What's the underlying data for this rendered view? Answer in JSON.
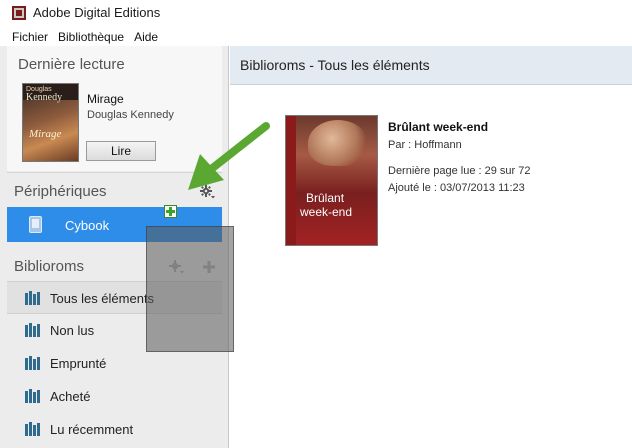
{
  "window": {
    "title": "Adobe Digital Editions"
  },
  "menu": [
    "Fichier",
    "Bibliothèque",
    "Aide"
  ],
  "sidebar": {
    "last_read": {
      "heading": "Dernière lecture",
      "book_title": "Mirage",
      "book_author": "Douglas Kennedy",
      "read_button": "Lire",
      "cover_author": "Douglas",
      "cover_name": "Kennedy",
      "cover_title": "Mirage"
    },
    "devices": {
      "heading": "Périphériques",
      "items": [
        {
          "label": "Cybook",
          "selected": true
        }
      ]
    },
    "bookshelves": {
      "heading": "Biblioroms",
      "items": [
        {
          "label": "Tous les éléments",
          "selected": true
        },
        {
          "label": "Non lus"
        },
        {
          "label": "Emprunté"
        },
        {
          "label": "Acheté"
        },
        {
          "label": "Lu récemment"
        }
      ]
    }
  },
  "main": {
    "header": "Biblioroms - Tous les éléments",
    "book": {
      "title": "Brûlant week-end",
      "author_line": "Par :  Hoffmann",
      "last_page_line": "Dernière page lue :  29 sur 72",
      "added_line": "Ajouté le :  03/07/2013 11:23",
      "cover_line1": "Brûlant",
      "cover_line2": "week-end"
    }
  },
  "colors": {
    "selection": "#2e8de8",
    "arrow": "#5aa832",
    "header_bg": "#e3eaf1",
    "sidebar_bg": "#ececec"
  }
}
